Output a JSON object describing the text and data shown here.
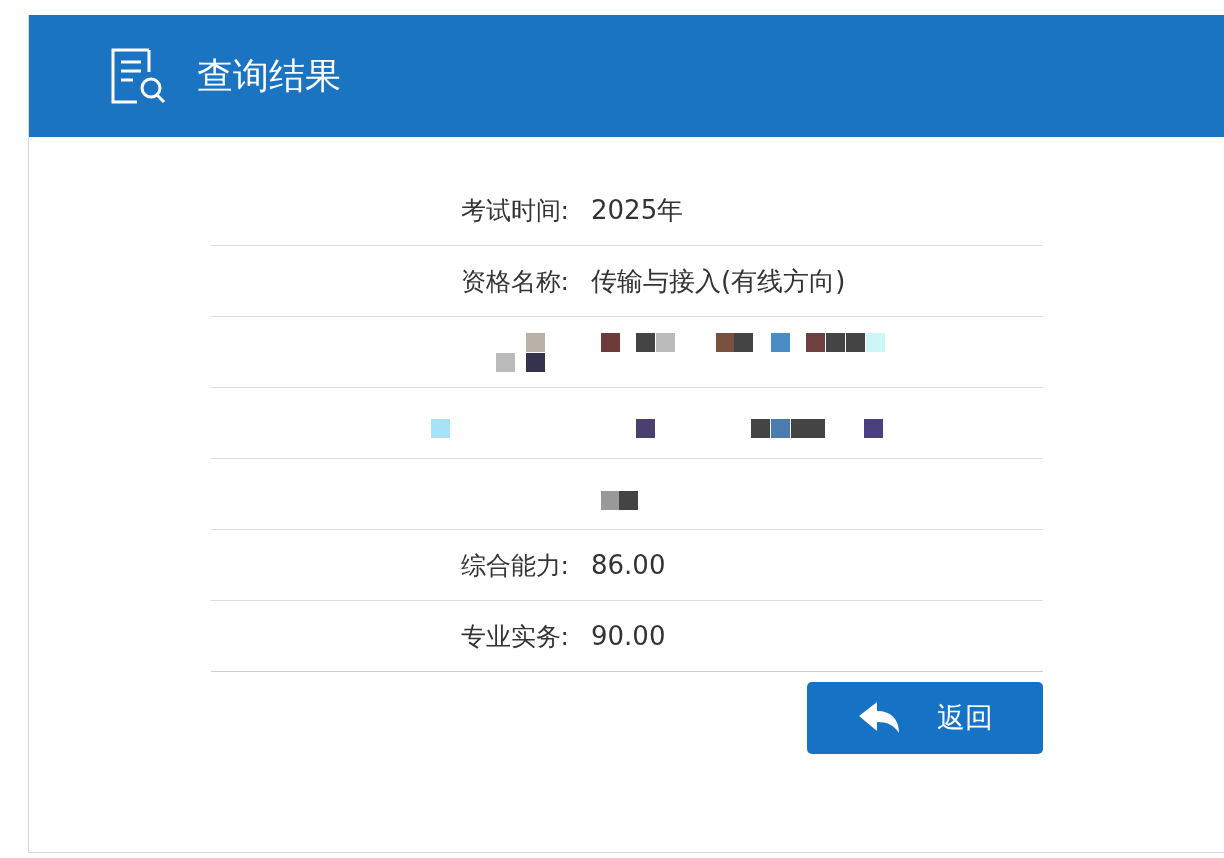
{
  "header": {
    "title": "查询结果"
  },
  "rows": [
    {
      "kind": "field",
      "label": "考试时间:",
      "value": "2025年"
    },
    {
      "kind": "field",
      "label": "资格名称:",
      "value": "传输与接入(有线方向)"
    },
    {
      "kind": "redacted"
    },
    {
      "kind": "redacted"
    },
    {
      "kind": "redacted"
    },
    {
      "kind": "field",
      "label": "综合能力:",
      "value": "86.00"
    },
    {
      "kind": "field",
      "label": "专业实务:",
      "value": "90.00"
    }
  ],
  "back_button": {
    "label": "返回"
  }
}
